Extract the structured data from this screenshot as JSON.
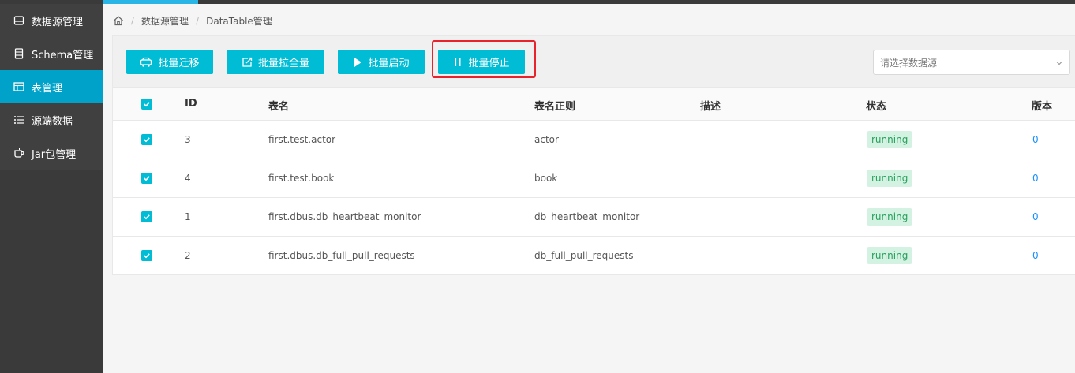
{
  "sidebar": {
    "items": [
      {
        "label": "数据源管理",
        "icon": "database-icon"
      },
      {
        "label": "Schema管理",
        "icon": "schema-icon"
      },
      {
        "label": "表管理",
        "icon": "table-icon",
        "active": true
      },
      {
        "label": "源端数据",
        "icon": "list-icon"
      },
      {
        "label": "Jar包管理",
        "icon": "coffee-icon"
      }
    ]
  },
  "breadcrumb": {
    "items": [
      "数据源管理",
      "DataTable管理"
    ],
    "separator": "/"
  },
  "toolbar": {
    "batch_migrate": "批量迁移",
    "batch_fullpull": "批量拉全量",
    "batch_start": "批量启动",
    "batch_stop": "批量停止",
    "datasource_placeholder": "请选择数据源"
  },
  "table": {
    "columns": [
      "ID",
      "表名",
      "表名正则",
      "描述",
      "状态",
      "版本"
    ],
    "rows": [
      {
        "id": "3",
        "name": "first.test.actor",
        "regex": "actor",
        "desc": "",
        "status": "running",
        "version": "0"
      },
      {
        "id": "4",
        "name": "first.test.book",
        "regex": "book",
        "desc": "",
        "status": "running",
        "version": "0"
      },
      {
        "id": "1",
        "name": "first.dbus.db_heartbeat_monitor",
        "regex": "db_heartbeat_monitor",
        "desc": "",
        "status": "running",
        "version": "0"
      },
      {
        "id": "2",
        "name": "first.dbus.db_full_pull_requests",
        "regex": "db_full_pull_requests",
        "desc": "",
        "status": "running",
        "version": "0"
      }
    ]
  },
  "colors": {
    "accent": "#00bcd4",
    "sidebar_bg": "#3a3a3a",
    "sidebar_active": "#00a2c9",
    "status_bg": "#d4f2e2",
    "status_fg": "#27a05c",
    "highlight": "#e8232b"
  }
}
